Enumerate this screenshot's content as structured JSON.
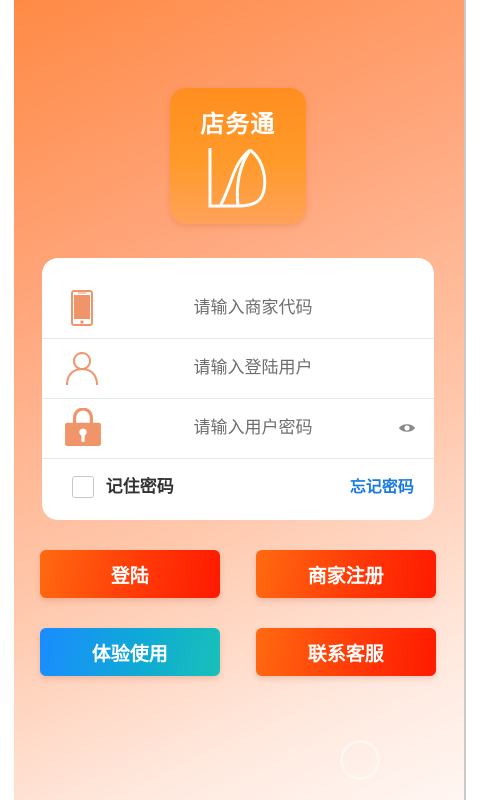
{
  "app": {
    "logo_text": "店务通"
  },
  "login_form": {
    "merchant_code": {
      "placeholder": "请输入商家代码",
      "icon": "phone-icon"
    },
    "username": {
      "placeholder": "请输入登陆用户",
      "icon": "user-icon"
    },
    "password": {
      "placeholder": "请输入用户密码",
      "icon": "lock-icon",
      "visibility_icon": "eye-icon"
    },
    "remember_label": "记住密码",
    "remember_checked": false,
    "forgot_label": "忘记密码"
  },
  "buttons": {
    "login": "登陆",
    "register": "商家注册",
    "trial": "体验使用",
    "support": "联系客服"
  },
  "colors": {
    "accent_orange": "#ff8e1f",
    "icon_orange": "#f0956a",
    "link_blue": "#1a7ae0",
    "button_red": "#ff3a08",
    "button_blue": "#1a8cff"
  }
}
